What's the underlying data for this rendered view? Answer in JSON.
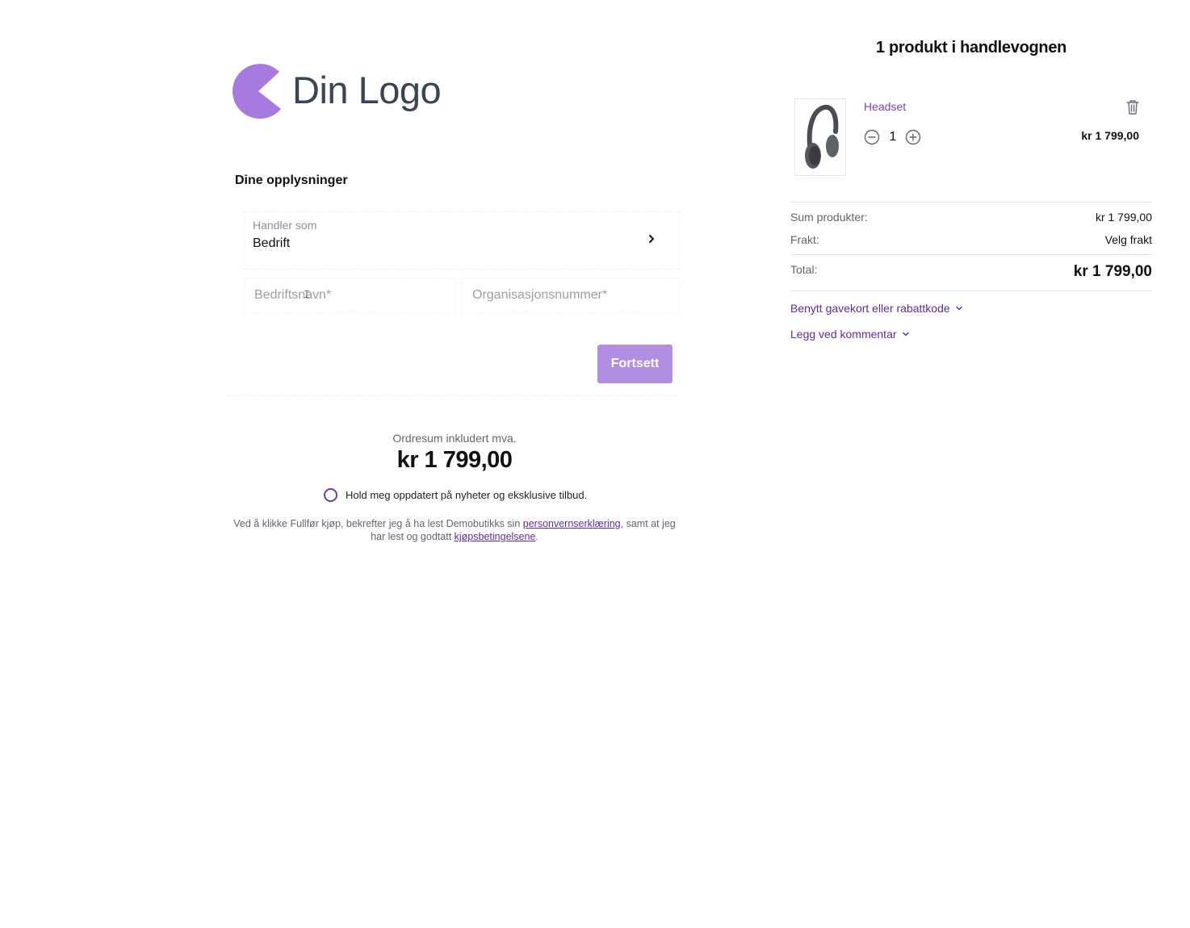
{
  "logo": {
    "text": "Din Logo",
    "mark_color": "#a77ae0"
  },
  "form": {
    "section_title": "Dine opplysninger",
    "handler_som": {
      "label": "Handler som",
      "value": "Bedrift"
    },
    "company_name": {
      "placeholder": "Bedriftsnavn*",
      "value": ""
    },
    "org_number": {
      "placeholder": "Organisasjonsnummer*",
      "value": ""
    },
    "continue_label": "Fortsett"
  },
  "summary": {
    "label": "Ordresum inkludert mva.",
    "amount": "kr 1 799,00"
  },
  "newsletter": {
    "label": "Hold meg oppdatert på nyheter og eksklusive tilbud.",
    "checked": false
  },
  "terms": {
    "before": "Ved å klikke Fullfør kjøp, bekrefter jeg å ha lest Demobutikks sin ",
    "privacy_link": "personvernserklæring",
    "middle": ", samt at jeg har lest og godtatt ",
    "terms_link": "kjøpsbetingelsene",
    "after": "."
  },
  "cart": {
    "title": "1 produkt i handlevognen",
    "items": [
      {
        "name": "Headset",
        "quantity": "1",
        "price": "kr 1 799,00",
        "image_icon": "headphones-image"
      }
    ],
    "sum_label": "Sum produkter:",
    "sum_value": "kr 1 799,00",
    "shipping_label": "Frakt:",
    "shipping_value": "Velg frakt",
    "total_label": "Total:",
    "total_value": "kr 1 799,00",
    "gift_card_link": "Benytt gavekort eller rabattkode",
    "comment_link": "Legg ved kommentar"
  },
  "colors": {
    "accent": "#b08ee2",
    "link": "#5c2e9e",
    "brand": "#a77ae0"
  }
}
